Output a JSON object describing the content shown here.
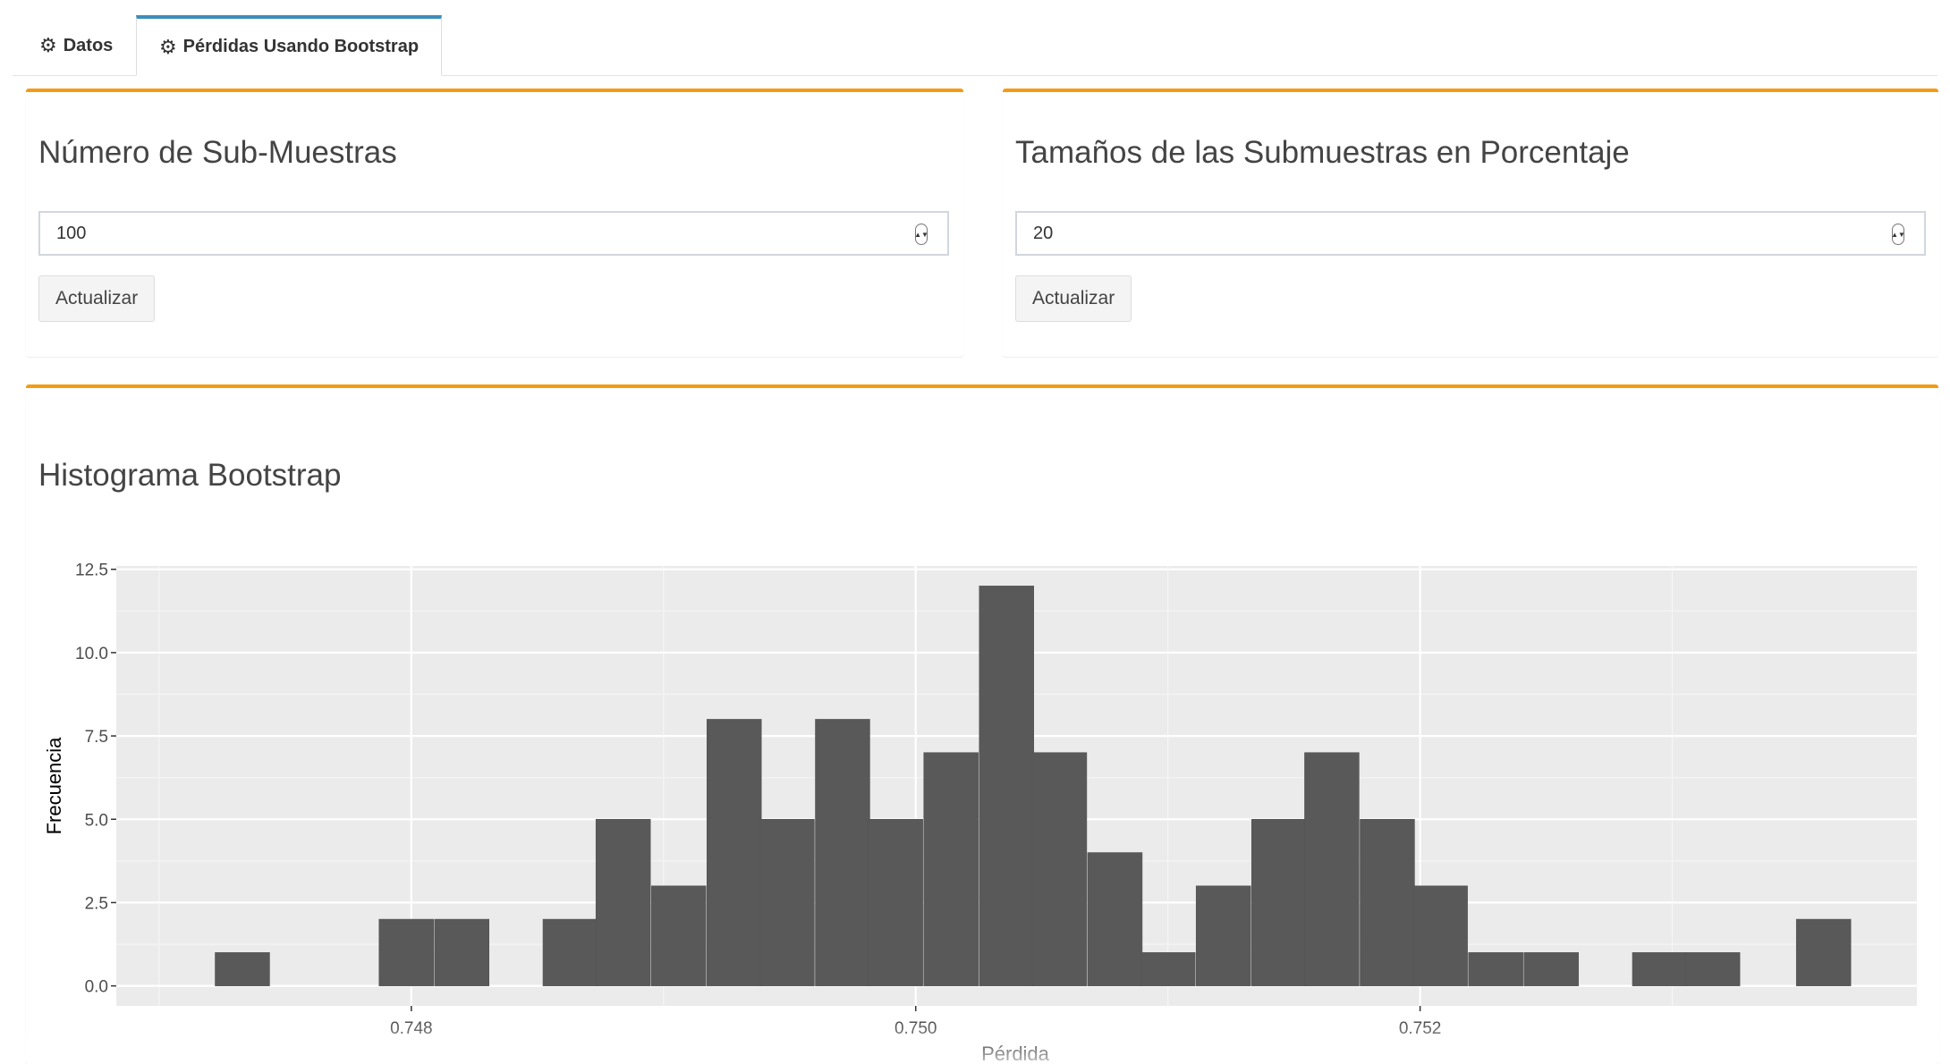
{
  "tabs": [
    {
      "label": "Datos",
      "icon": "gear-icon",
      "active": false
    },
    {
      "label": "Pérdidas Usando Bootstrap",
      "icon": "gear-icon",
      "active": true
    }
  ],
  "colors": {
    "box_border": "#f39c12",
    "tab_active": "#3c8dbc",
    "bars": "#595959",
    "panel": "#ebebeb"
  },
  "box_submuestras": {
    "title": "Número de Sub-Muestras",
    "input_value": "100",
    "button_label": "Actualizar"
  },
  "box_tamanos": {
    "title": "Tamaños de las Submuestras en Porcentaje",
    "input_value": "20",
    "button_label": "Actualizar"
  },
  "box_histograma": {
    "title": "Histograma Bootstrap"
  },
  "chart_data": {
    "type": "bar",
    "title": "",
    "xlabel": "Pérdida",
    "ylabel": "Frecuencia",
    "bin_width": 0.000216,
    "x": [
      0.74733,
      0.74798,
      0.7482,
      0.74863,
      0.74884,
      0.74906,
      0.74928,
      0.74949,
      0.74971,
      0.74992,
      0.75014,
      0.75036,
      0.75057,
      0.75079,
      0.751,
      0.75122,
      0.75144,
      0.75165,
      0.75187,
      0.75208,
      0.7523,
      0.75252,
      0.75295,
      0.75316,
      0.7536
    ],
    "values": [
      1,
      2,
      2,
      2,
      5,
      3,
      8,
      5,
      8,
      5,
      7,
      12,
      7,
      4,
      1,
      3,
      5,
      7,
      5,
      3,
      1,
      1,
      1,
      1,
      2
    ],
    "xlim": [
      0.74683,
      0.75397
    ],
    "ylim": [
      -0.6,
      12.6
    ],
    "x_ticks": [
      0.748,
      0.75,
      0.752
    ],
    "x_tick_labels": [
      "0.748",
      "0.750",
      "0.752"
    ],
    "y_ticks": [
      0,
      2.5,
      5,
      7.5,
      10,
      12.5
    ],
    "y_tick_labels": [
      "0.0",
      "2.5",
      "5.0",
      "7.5",
      "10.0",
      "12.5"
    ],
    "grid": true,
    "legend": "none"
  }
}
